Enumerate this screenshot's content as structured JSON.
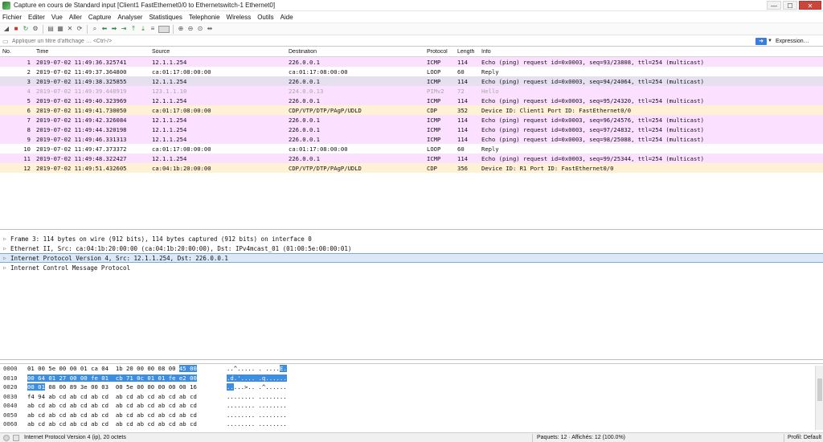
{
  "window": {
    "title": "Capture en cours de Standard input [Client1 FastEthernet0/0 to Ethernetswitch-1 Ethernet0]",
    "minimize": "—",
    "maximize": "☐",
    "close": "✕"
  },
  "menu": [
    "Fichier",
    "Editer",
    "Vue",
    "Aller",
    "Capture",
    "Analyser",
    "Statistiques",
    "Telephonie",
    "Wireless",
    "Outils",
    "Aide"
  ],
  "filter": {
    "placeholder": "Appliquer un filtre d'affichage … <Ctrl-/>",
    "expression_label": "Expression…"
  },
  "packet_list": {
    "columns": [
      "No.",
      "Time",
      "Source",
      "Destination",
      "Protocol",
      "Length",
      "Info"
    ],
    "rows": [
      {
        "no": "1",
        "time": "2019-07-02 11:49:36.325741",
        "src": "12.1.1.254",
        "dst": "226.0.0.1",
        "proto": "ICMP",
        "len": "114",
        "info": "Echo (ping) request  id=0x0003, seq=93/23808, ttl=254 (multicast)",
        "kind": "icmp"
      },
      {
        "no": "2",
        "time": "2019-07-02 11:49:37.364800",
        "src": "ca:01:17:08:00:00",
        "dst": "ca:01:17:08:00:00",
        "proto": "LOOP",
        "len": "60",
        "info": "Reply",
        "kind": "loop"
      },
      {
        "no": "3",
        "time": "2019-07-02 11:49:38.325855",
        "src": "12.1.1.254",
        "dst": "226.0.0.1",
        "proto": "ICMP",
        "len": "114",
        "info": "Echo (ping) request  id=0x0003, seq=94/24064, ttl=254 (multicast)",
        "kind": "selected"
      },
      {
        "no": "4",
        "time": "2019-07-02 11:49:39.448919",
        "src": "123.1.1.10",
        "dst": "224.0.0.13",
        "proto": "PIMv2",
        "len": "72",
        "info": "Hello",
        "kind": "pim"
      },
      {
        "no": "5",
        "time": "2019-07-02 11:49:40.323969",
        "src": "12.1.1.254",
        "dst": "226.0.0.1",
        "proto": "ICMP",
        "len": "114",
        "info": "Echo (ping) request  id=0x0003, seq=95/24320, ttl=254 (multicast)",
        "kind": "icmp"
      },
      {
        "no": "6",
        "time": "2019-07-02 11:49:41.730050",
        "src": "ca:01:17:08:00:00",
        "dst": "CDP/VTP/DTP/PAgP/UDLD",
        "proto": "CDP",
        "len": "352",
        "info": "Device ID: Client1  Port ID: FastEthernet0/0",
        "kind": "cdp"
      },
      {
        "no": "7",
        "time": "2019-07-02 11:49:42.326084",
        "src": "12.1.1.254",
        "dst": "226.0.0.1",
        "proto": "ICMP",
        "len": "114",
        "info": "Echo (ping) request  id=0x0003, seq=96/24576, ttl=254 (multicast)",
        "kind": "icmp"
      },
      {
        "no": "8",
        "time": "2019-07-02 11:49:44.320198",
        "src": "12.1.1.254",
        "dst": "226.0.0.1",
        "proto": "ICMP",
        "len": "114",
        "info": "Echo (ping) request  id=0x0003, seq=97/24832, ttl=254 (multicast)",
        "kind": "icmp"
      },
      {
        "no": "9",
        "time": "2019-07-02 11:49:46.331313",
        "src": "12.1.1.254",
        "dst": "226.0.0.1",
        "proto": "ICMP",
        "len": "114",
        "info": "Echo (ping) request  id=0x0003, seq=98/25088, ttl=254 (multicast)",
        "kind": "icmp"
      },
      {
        "no": "10",
        "time": "2019-07-02 11:49:47.373372",
        "src": "ca:01:17:08:00:00",
        "dst": "ca:01:17:08:00:00",
        "proto": "LOOP",
        "len": "60",
        "info": "Reply",
        "kind": "loop"
      },
      {
        "no": "11",
        "time": "2019-07-02 11:49:48.322427",
        "src": "12.1.1.254",
        "dst": "226.0.0.1",
        "proto": "ICMP",
        "len": "114",
        "info": "Echo (ping) request  id=0x0003, seq=99/25344, ttl=254 (multicast)",
        "kind": "icmp"
      },
      {
        "no": "12",
        "time": "2019-07-02 11:49:51.432605",
        "src": "ca:04:1b:20:00:00",
        "dst": "CDP/VTP/DTP/PAgP/UDLD",
        "proto": "CDP",
        "len": "356",
        "info": "Device ID: R1  Port ID: FastEthernet0/0",
        "kind": "cdp"
      }
    ]
  },
  "details": [
    {
      "text": "Frame 3: 114 bytes on wire (912 bits), 114 bytes captured (912 bits) on interface 0",
      "selected": false
    },
    {
      "text": "Ethernet II, Src: ca:04:1b:20:00:00 (ca:04:1b:20:00:00), Dst: IPv4mcast_01 (01:00:5e:00:00:01)",
      "selected": false
    },
    {
      "text": "Internet Protocol Version 4, Src: 12.1.1.254, Dst: 226.0.0.1",
      "selected": true
    },
    {
      "text": "Internet Control Message Protocol",
      "selected": false
    }
  ],
  "hex": [
    {
      "off": "0000",
      "pre": "01 00 5e 00 00 01 ca 04  1b 20 00 00 08 00 ",
      "hl": "45 00",
      "post": "",
      "apre": "..^..... . ....",
      "ahl": "E.",
      "apost": ""
    },
    {
      "off": "0010",
      "pre": "",
      "hl": "00 64 01 27 00 00 fe 01  cb 71 0c 01 01 fe e2 00",
      "post": "",
      "apre": "",
      "ahl": ".d.'.... .q......",
      "apost": ""
    },
    {
      "off": "0020",
      "pre": "",
      "hl": "00 01",
      "post": " 08 00 89 3e 00 03  00 5e 00 00 00 00 00 16",
      "apre": "",
      "ahl": "..",
      "apost": "...>.. .^......"
    },
    {
      "off": "0030",
      "pre": "f4 94 ab cd ab cd ab cd  ab cd ab cd ab cd ab cd",
      "hl": "",
      "post": "",
      "apre": "........ ........",
      "ahl": "",
      "apost": ""
    },
    {
      "off": "0040",
      "pre": "ab cd ab cd ab cd ab cd  ab cd ab cd ab cd ab cd",
      "hl": "",
      "post": "",
      "apre": "........ ........",
      "ahl": "",
      "apost": ""
    },
    {
      "off": "0050",
      "pre": "ab cd ab cd ab cd ab cd  ab cd ab cd ab cd ab cd",
      "hl": "",
      "post": "",
      "apre": "........ ........",
      "ahl": "",
      "apost": ""
    },
    {
      "off": "0060",
      "pre": "ab cd ab cd ab cd ab cd  ab cd ab cd ab cd ab cd",
      "hl": "",
      "post": "",
      "apre": "........ ........",
      "ahl": "",
      "apost": ""
    }
  ],
  "status": {
    "field": "Internet Protocol Version 4 (ip), 20 octets",
    "packets": "Paquets: 12 · Affichés: 12 (100.0%)",
    "profile": "Profil: Default"
  },
  "colors": {
    "icmp_row": "#fce0ff",
    "cdp_row": "#fff1d4",
    "selection": "#3d8ee0"
  }
}
